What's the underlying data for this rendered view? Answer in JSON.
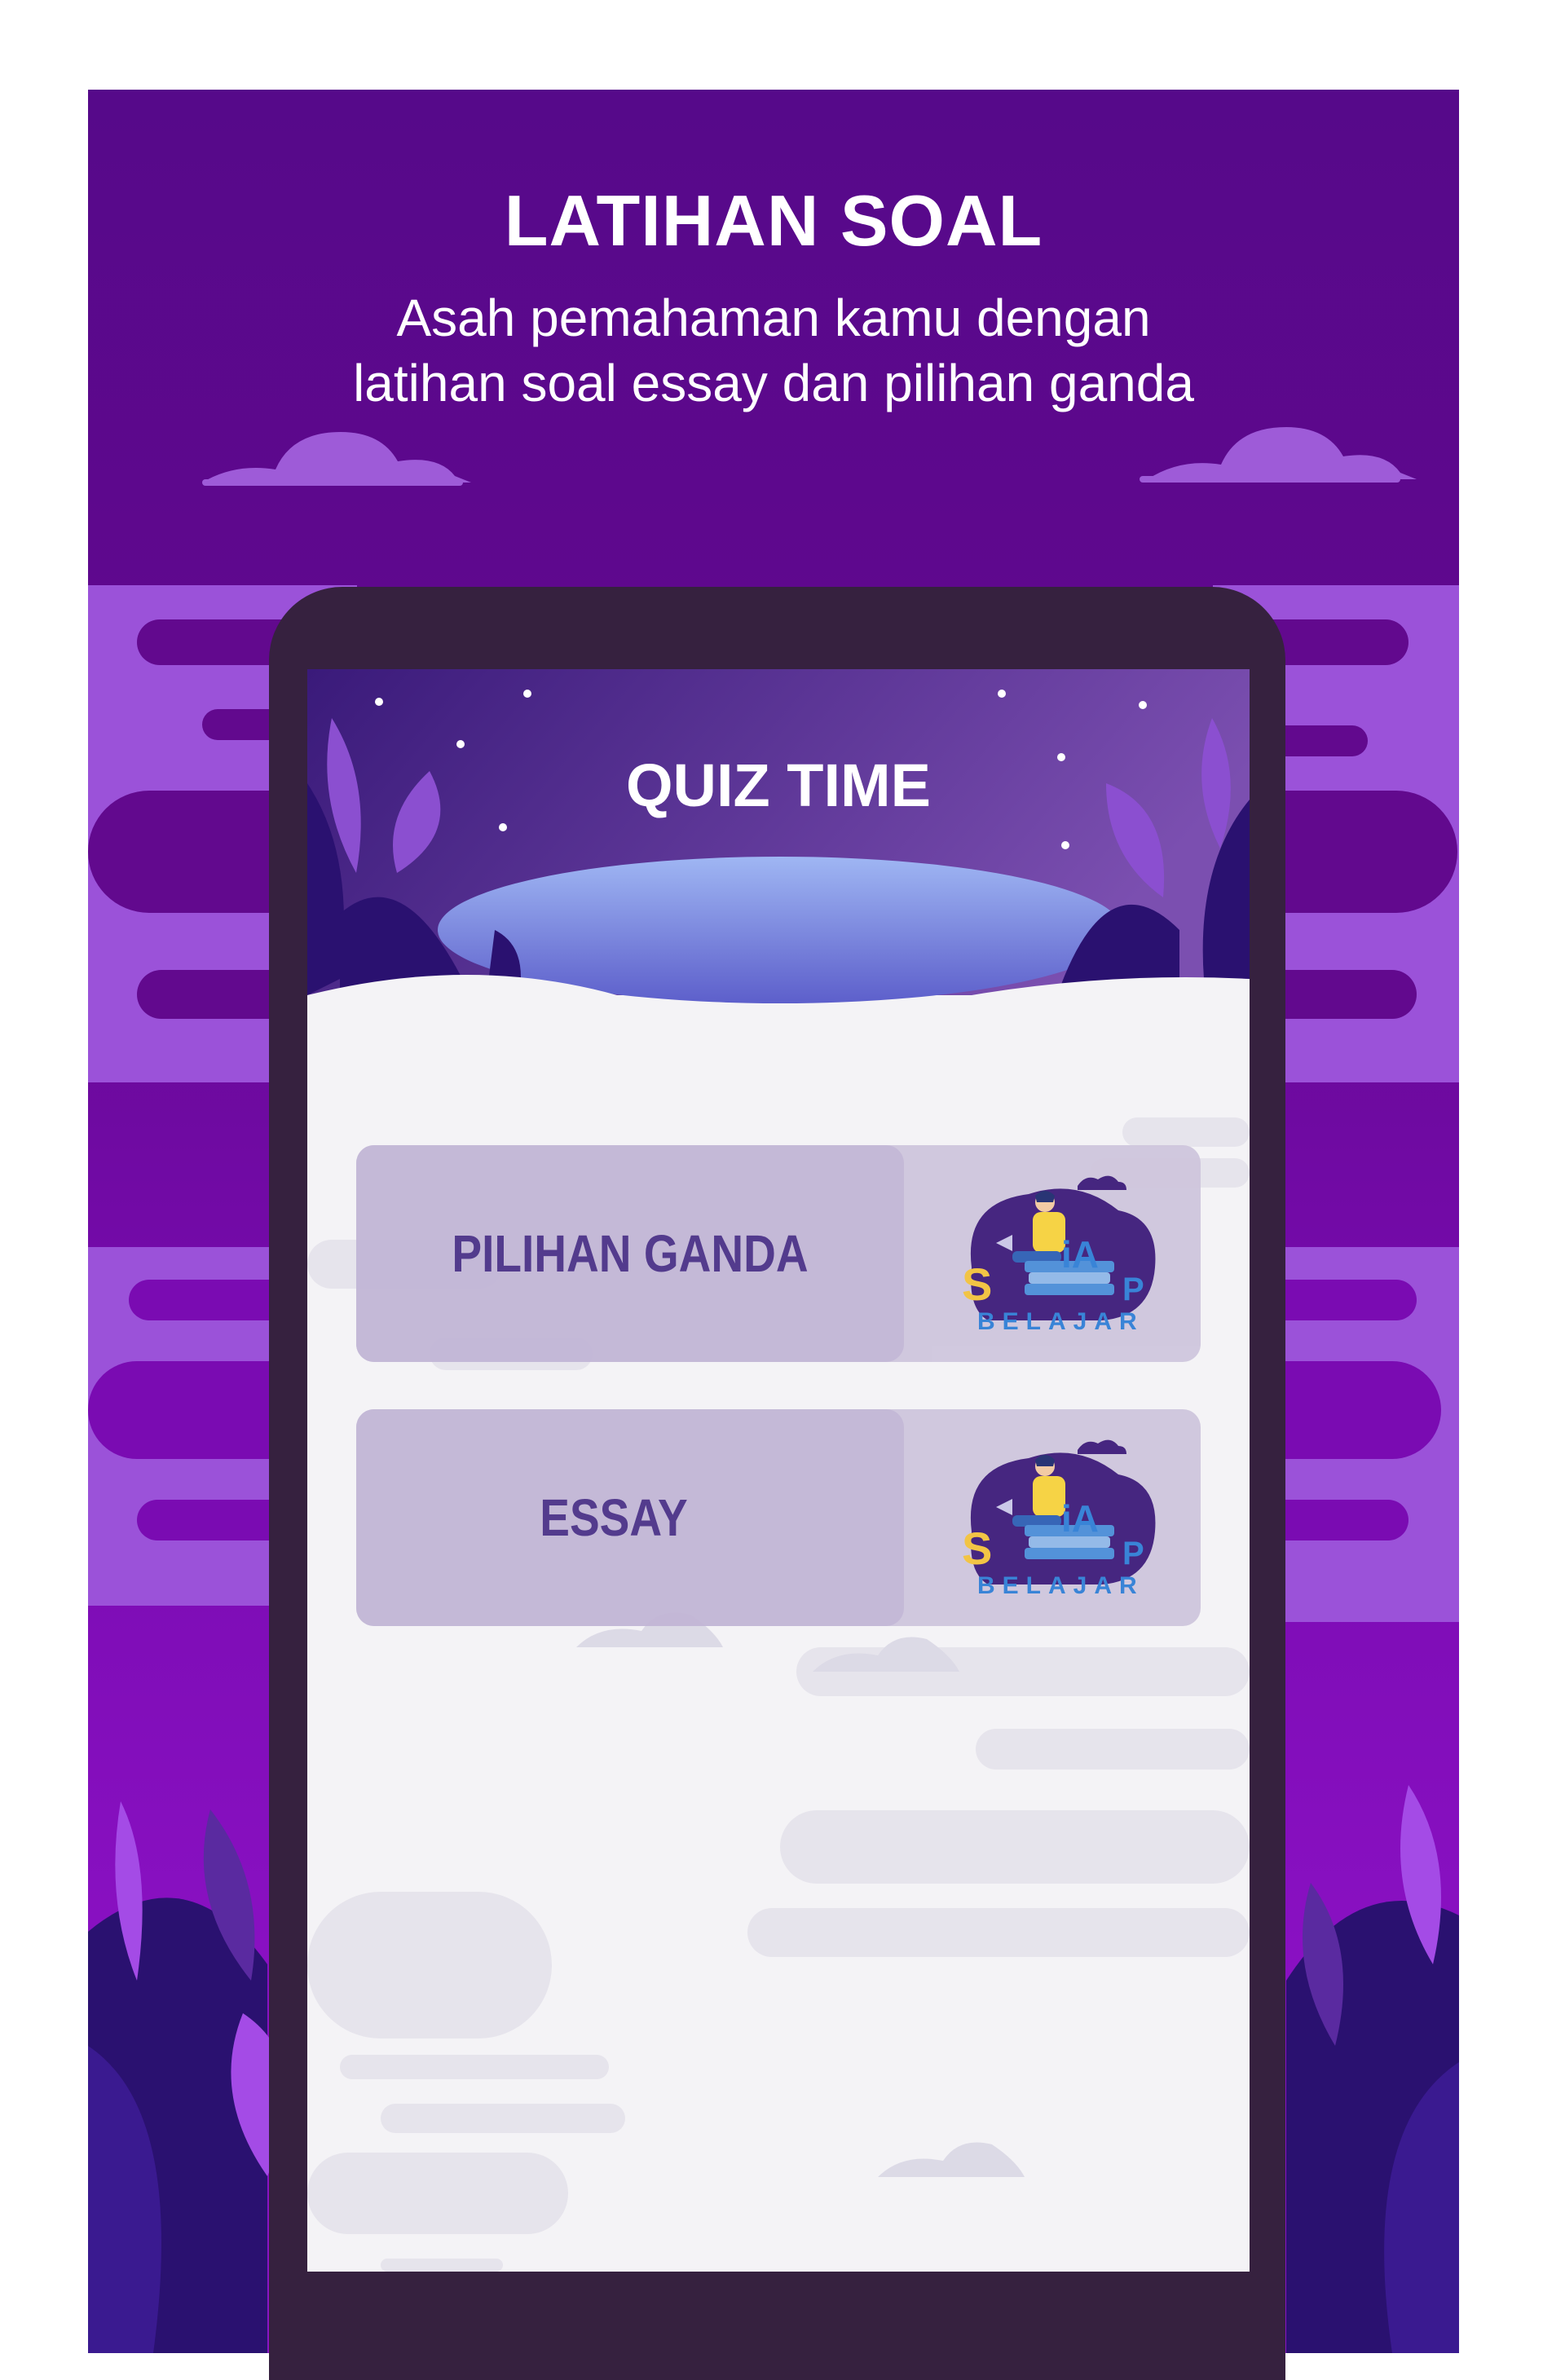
{
  "header": {
    "title": "LATIHAN SOAL",
    "subtitle_line1": "Asah pemahaman kamu dengan",
    "subtitle_line2": "latihan soal essay dan pilihan ganda"
  },
  "app": {
    "screen_title": "QUIZ TIME",
    "menu": [
      {
        "label": "PILIHAN GANDA",
        "logo_text": "BELAJAR"
      },
      {
        "label": "ESSAY",
        "logo_text": "BELAJAR"
      }
    ]
  },
  "colors": {
    "brand_purple": "#56098a",
    "button_text": "#4b3288",
    "logo_blue": "#2f7fd6",
    "phone_frame": "#36213f"
  },
  "icons": [
    "cloud-icon",
    "leaf-icon",
    "star-icon",
    "reading-student-logo-icon"
  ]
}
